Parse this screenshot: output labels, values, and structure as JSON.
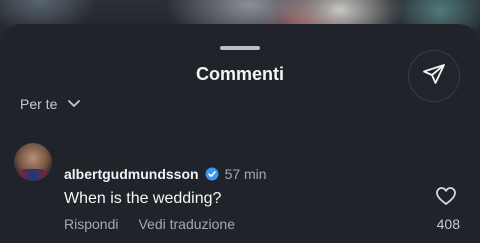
{
  "header": {
    "title": "Commenti",
    "share_icon": "send-icon"
  },
  "filter": {
    "label": "Per te",
    "icon": "chevron-down-icon"
  },
  "comment": {
    "username": "albertgudmundsson",
    "verified": true,
    "time": "57 min",
    "text": "When is the wedding?",
    "reply_label": "Rispondi",
    "translate_label": "Vedi traduzione",
    "likes": "408",
    "like_icon": "heart-icon"
  },
  "colors": {
    "background": "#21232a",
    "verified_badge": "#3897f0",
    "secondary_text": "#a7a8ad"
  }
}
